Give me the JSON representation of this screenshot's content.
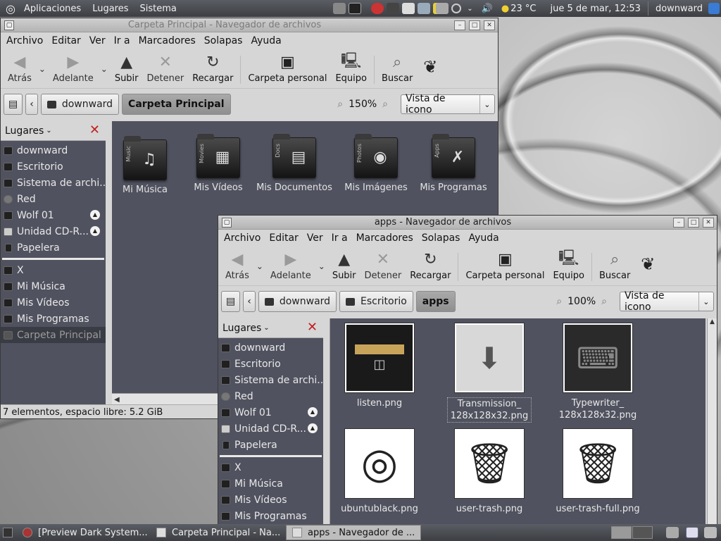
{
  "top_panel": {
    "menus": [
      "Aplicaciones",
      "Lugares",
      "Sistema"
    ],
    "temperature": "23 °C",
    "clock": "jue  5 de mar, 12:53",
    "user": "downward"
  },
  "window1": {
    "title": "Carpeta Principal - Navegador de archivos",
    "menu": [
      "Archivo",
      "Editar",
      "Ver",
      "Ir a",
      "Marcadores",
      "Solapas",
      "Ayuda"
    ],
    "toolbar": {
      "back": "Atrás",
      "forward": "Adelante",
      "up": "Subir",
      "stop": "Detener",
      "reload": "Recargar",
      "home": "Carpeta personal",
      "computer": "Equipo",
      "search": "Buscar"
    },
    "path": [
      "downward",
      "Carpeta Principal"
    ],
    "zoom": "150%",
    "view": "Vista de icono",
    "sidebar_title": "Lugares",
    "places": [
      "downward",
      "Escritorio",
      "Sistema de archi...",
      "Red",
      "Wolf 01",
      "Unidad CD-R...",
      "Papelera"
    ],
    "bookmarks": [
      "X",
      "Mi Música",
      "Mis Vídeos",
      "Mis Programas",
      "Carpeta Principal"
    ],
    "folders": [
      {
        "name": "Mi Música",
        "tag": "Music"
      },
      {
        "name": "Mis Vídeos",
        "tag": "Movies"
      },
      {
        "name": "Mis Documentos",
        "tag": "Docs"
      },
      {
        "name": "Mis Imágenes",
        "tag": "Photos"
      },
      {
        "name": "Mis Programas",
        "tag": "Apps"
      }
    ],
    "status": "7 elementos, espacio libre: 5.2 GiB"
  },
  "window2": {
    "title": "apps - Navegador de archivos",
    "menu": [
      "Archivo",
      "Editar",
      "Ver",
      "Ir a",
      "Marcadores",
      "Solapas",
      "Ayuda"
    ],
    "toolbar": {
      "back": "Atrás",
      "forward": "Adelante",
      "up": "Subir",
      "stop": "Detener",
      "reload": "Recargar",
      "home": "Carpeta personal",
      "computer": "Equipo",
      "search": "Buscar"
    },
    "path": [
      "downward",
      "Escritorio",
      "apps"
    ],
    "zoom": "100%",
    "view": "Vista de icono",
    "sidebar_title": "Lugares",
    "places": [
      "downward",
      "Escritorio",
      "Sistema de archi...",
      "Red",
      "Wolf 01",
      "Unidad CD-R...",
      "Papelera"
    ],
    "bookmarks": [
      "X",
      "Mi Música",
      "Mis Vídeos",
      "Mis Programas"
    ],
    "files": [
      {
        "line1": "listen.png",
        "line2": ""
      },
      {
        "line1": "Transmission_",
        "line2": "128x128x32.png"
      },
      {
        "line1": "Typewriter_",
        "line2": "128x128x32.png"
      },
      {
        "line1": "ubuntublack.png",
        "line2": ""
      },
      {
        "line1": "user-trash.png",
        "line2": ""
      },
      {
        "line1": "user-trash-full.png",
        "line2": ""
      }
    ]
  },
  "taskbar": {
    "tasks": [
      "[Preview Dark System...",
      "Carpeta Principal - Na...",
      "apps - Navegador de ..."
    ]
  }
}
